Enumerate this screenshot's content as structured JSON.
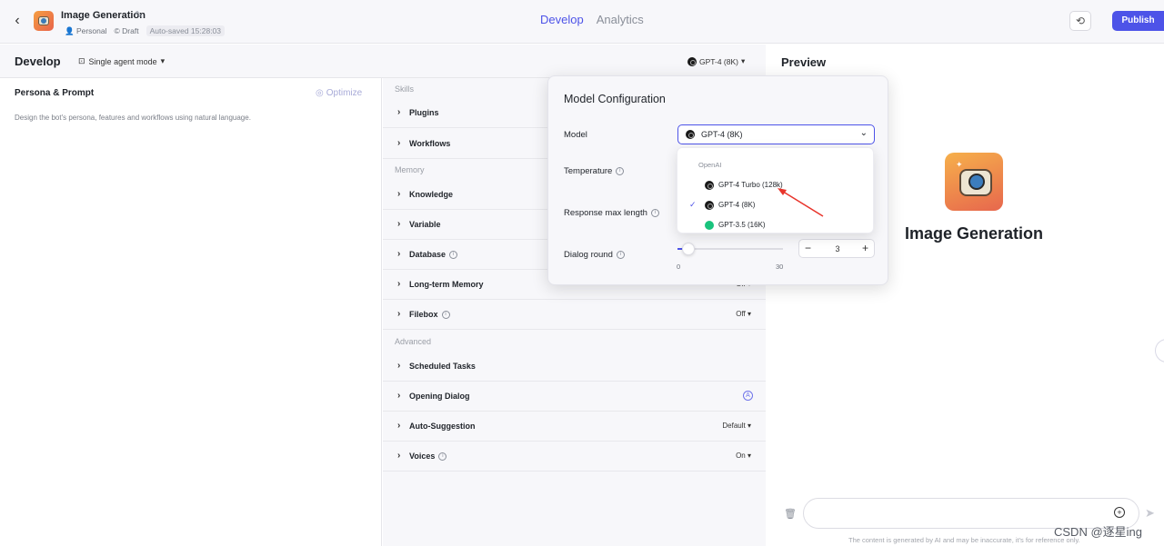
{
  "header": {
    "bot_name": "Image Generation",
    "space": "Personal",
    "status": "Draft",
    "autosave": "Auto-saved 15:28:03",
    "tabs": [
      {
        "label": "Develop",
        "active": true
      },
      {
        "label": "Analytics",
        "active": false
      }
    ],
    "publish_label": "Publish",
    "accent_color": "#4d53e8"
  },
  "devbar": {
    "title": "Develop",
    "mode": "Single agent mode",
    "model": "GPT-4 (8K)"
  },
  "persona": {
    "title": "Persona & Prompt",
    "optimize": "Optimize",
    "description": "Design the bot's persona, features and workflows using natural language."
  },
  "skills": {
    "sections": {
      "skills": "Skills",
      "memory": "Memory",
      "advanced": "Advanced"
    },
    "rows": {
      "plugins": {
        "label": "Plugins"
      },
      "workflows": {
        "label": "Workflows"
      },
      "knowledge": {
        "label": "Knowledge"
      },
      "variable": {
        "label": "Variable"
      },
      "database": {
        "label": "Database"
      },
      "long_term_memory": {
        "label": "Long-term Memory",
        "value": "Off"
      },
      "filebox": {
        "label": "Filebox",
        "value": "Off"
      },
      "scheduled_tasks": {
        "label": "Scheduled Tasks"
      },
      "opening_dialog": {
        "label": "Opening Dialog"
      },
      "auto_suggestion": {
        "label": "Auto-Suggestion",
        "value": "Default"
      },
      "voices": {
        "label": "Voices",
        "value": "On"
      }
    }
  },
  "model_config": {
    "title": "Model Configuration",
    "model_label": "Model",
    "selected_model": "GPT-4 (8K)",
    "temperature_label": "Temperature",
    "response_label": "Response max length",
    "dialog_round_label": "Dialog round",
    "dialog_round_value": "3",
    "dialog_round_min": "0",
    "dialog_round_max": "30",
    "dialog_round_fraction": 0.1,
    "dropdown": {
      "group": "OpenAI",
      "options": [
        {
          "label": "GPT-4 Turbo (128k)",
          "selected": false,
          "icon": "openai-icon"
        },
        {
          "label": "GPT-4 (8K)",
          "selected": true,
          "icon": "openai-icon"
        },
        {
          "label": "GPT-3.5 (16K)",
          "selected": false,
          "icon": "gpt35-icon"
        }
      ]
    }
  },
  "preview": {
    "title": "Preview",
    "bot_name": "Image Generation",
    "disclaimer": "The content is generated by AI and may be inaccurate, it's for reference only."
  },
  "watermark": "CSDN @逐星ing"
}
